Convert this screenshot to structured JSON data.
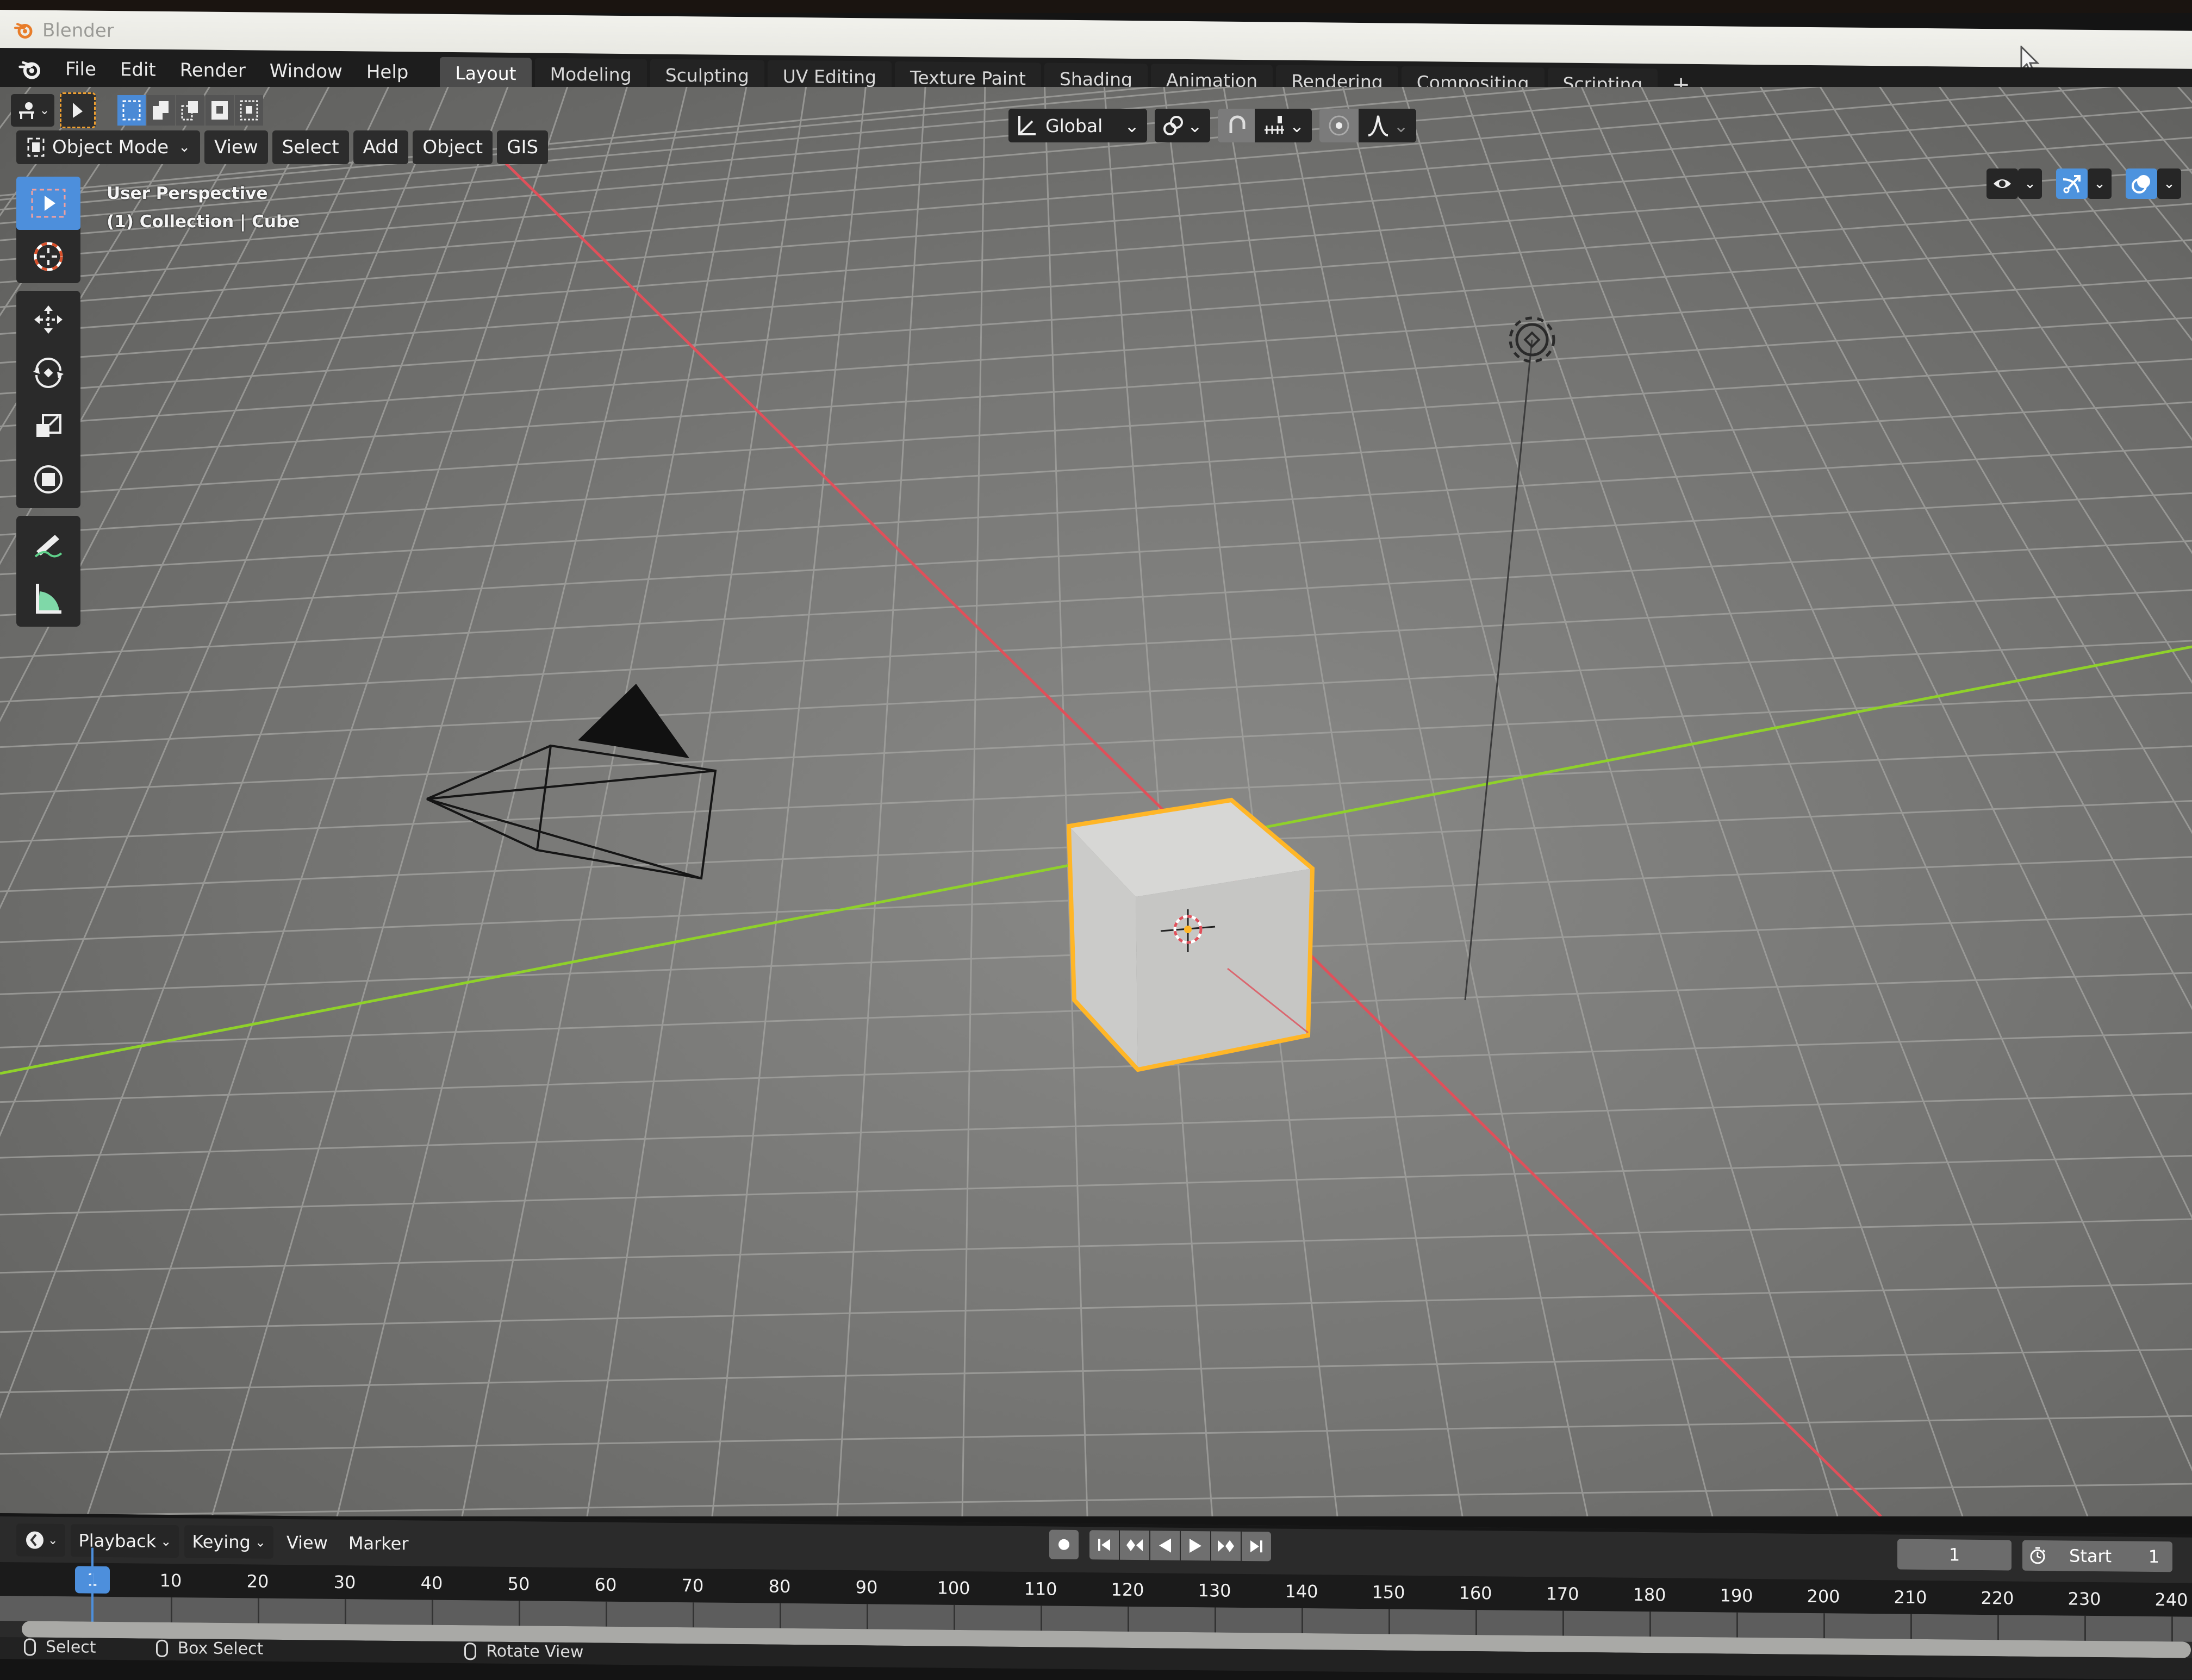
{
  "window": {
    "title": "Blender",
    "logo_icon": "blender-logo-icon",
    "cursor_icon": "mouse-pointer-icon"
  },
  "menu": {
    "items": [
      "File",
      "Edit",
      "Render",
      "Window",
      "Help"
    ]
  },
  "workspaces": {
    "tabs": [
      "Layout",
      "Modeling",
      "Sculpting",
      "UV Editing",
      "Texture Paint",
      "Shading",
      "Animation",
      "Rendering",
      "Compositing",
      "Scripting"
    ],
    "active": "Layout",
    "add_label": "+"
  },
  "viewport_header": {
    "editor_type_icon": "3d-viewport-icon",
    "select_tool_icon": "select-cursor-icon",
    "selection_modes": [
      "set-new-selection",
      "extend-selection",
      "subtract-selection",
      "invert-selection",
      "intersect-selection"
    ],
    "mode_label": "Object Mode",
    "menus": [
      "View",
      "Select",
      "Add",
      "Object",
      "GIS"
    ],
    "transform_orientation": "Global",
    "pivot_icon": "pivot-point-icon",
    "snap_icon": "magnet-snap-icon",
    "snap_increment_icon": "snap-increment-icon",
    "proportional_icon": "proportional-editing-icon",
    "falloff_icon": "falloff-curve-icon",
    "right_icons": [
      "visibility-icon",
      "gizmo-icon",
      "overlay-icon"
    ]
  },
  "viewport": {
    "perspective_label": "User Perspective",
    "context_label": "(1) Collection | Cube",
    "objects": [
      "Camera",
      "Cube",
      "Light"
    ],
    "selected_object": "Cube",
    "colors": {
      "x_axis": "#e0505a",
      "y_axis": "#8fd12a",
      "selection_outline": "#ffb627"
    }
  },
  "toolbar": {
    "tools": [
      {
        "name": "select-box",
        "active": true
      },
      {
        "name": "cursor",
        "active": false
      },
      {
        "name": "move",
        "active": false
      },
      {
        "name": "rotate",
        "active": false
      },
      {
        "name": "scale",
        "active": false
      },
      {
        "name": "transform",
        "active": false
      },
      {
        "name": "annotate",
        "active": false
      },
      {
        "name": "measure",
        "active": false
      }
    ]
  },
  "timeline": {
    "editor_icon": "timeline-icon",
    "menus": [
      "Playback",
      "Keying",
      "View",
      "Marker"
    ],
    "current_frame": "1",
    "start_label": "Start",
    "start_value": "1",
    "ruler_labels": [
      "10",
      "20",
      "30",
      "40",
      "50",
      "60",
      "70",
      "80",
      "90",
      "100",
      "110",
      "120",
      "130",
      "140",
      "150",
      "160",
      "170",
      "180",
      "190",
      "200",
      "210",
      "220",
      "230",
      "240"
    ],
    "transport": [
      "record",
      "jump-start",
      "prev-keyframe",
      "play-reverse",
      "play",
      "next-keyframe",
      "jump-end"
    ]
  },
  "statusbar": {
    "items": [
      "Select",
      "Box Select",
      "Rotate View"
    ]
  }
}
